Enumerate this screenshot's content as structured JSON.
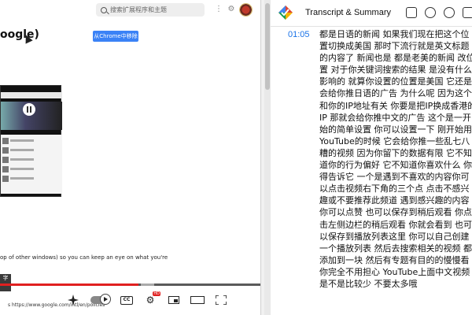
{
  "video": {
    "search_placeholder": "搜索扩展程序和主题",
    "title_fragment": "oogle)",
    "chrome_button": "从Chrome中移除",
    "caption": "op of other windows) so you can keep an eye on what you're",
    "url": "s https://www.google.com/intl/en/policies",
    "corner_label": "字",
    "progress_played": 0.54,
    "progress_buffered": 0.53,
    "hd_badge": "HD",
    "cc_label": "CC"
  },
  "panel": {
    "title": "Transcript & Summary",
    "timestamp": "01:05",
    "transcript": "都是日语的新闻 如果我们现在把这个位置切换成美国 那时下流行就是英文标题的内容了 新闻也是 都是老美的新闻 改位置 对于你关键词搜索的结果 是没有什么影响的 就算你设置的位置是美国 它还是会给你推日语的广告 为什么呢 因为这个和你的IP地址有关 你要是把IP换成香港的IP 那就会给你推中文的广告 这个是一开始的简单设置 你可以设置一下 刚开始用YouTube的时候 它会给你推一些乱七八糟的视频 因为你留下的数据有限 它不知道你的行为偏好 它不知道你喜欢什么 你得告诉它 一个是遇到不喜欢的内容你可以点击视频右下角的三个点 点击不感兴趣或不要推荐此频道 遇到感兴趣的内容 你可以点赞 也可以保存到稍后观看 你点击左侧边栏的稍后观看 你就会看到 也可以保存到播放列表这里 你可以自己创建一个播放列表 然后去搜索相关的视频 都添加到一块 然后有专题有目的的慢慢看 你完全不用担心 YouTube上面中文视频是不是比较少 不要太多哦"
  },
  "colors": {
    "accent": "#1a73e8",
    "progress": "#e02020",
    "button": "#3b82f6"
  }
}
